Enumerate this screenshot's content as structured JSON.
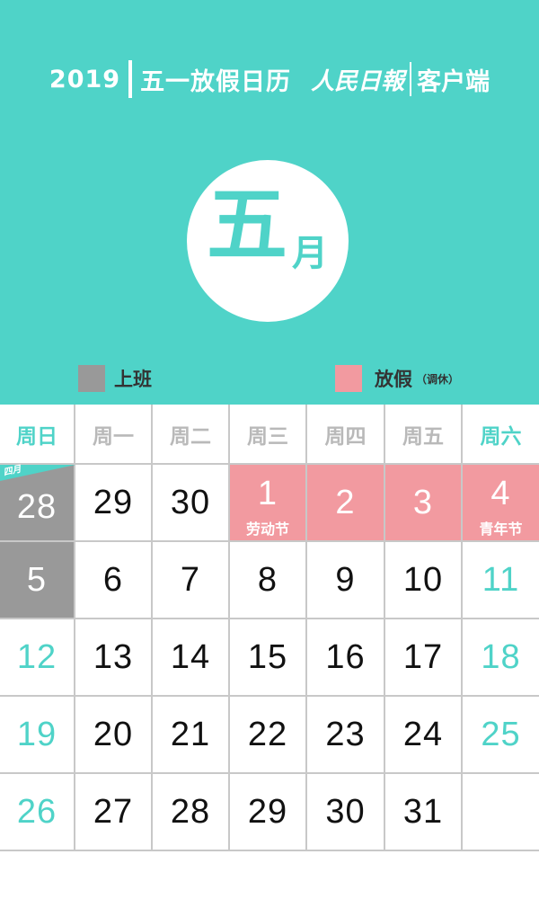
{
  "header": {
    "year": "2019",
    "title": "五一放假日历",
    "brand": "人民日報",
    "client": "客户端",
    "month_big": "五",
    "month_small": "月",
    "background_color": "#4fd3c8"
  },
  "legend": {
    "work": {
      "label": "上班",
      "color": "#999999"
    },
    "holiday": {
      "label": "放假",
      "note": "（调休）",
      "color": "#f29aa0"
    }
  },
  "calendar": {
    "weekdays": [
      "周日",
      "周一",
      "周二",
      "周三",
      "周四",
      "周五",
      "周六"
    ],
    "weeks": [
      [
        {
          "day": "28",
          "type": "work",
          "tag": "四月"
        },
        {
          "day": "29",
          "type": "normal"
        },
        {
          "day": "30",
          "type": "normal"
        },
        {
          "day": "1",
          "type": "holiday",
          "note": "劳动节"
        },
        {
          "day": "2",
          "type": "holiday"
        },
        {
          "day": "3",
          "type": "holiday"
        },
        {
          "day": "4",
          "type": "holiday",
          "note": "青年节"
        }
      ],
      [
        {
          "day": "5",
          "type": "work"
        },
        {
          "day": "6",
          "type": "normal"
        },
        {
          "day": "7",
          "type": "normal"
        },
        {
          "day": "8",
          "type": "normal"
        },
        {
          "day": "9",
          "type": "normal"
        },
        {
          "day": "10",
          "type": "normal"
        },
        {
          "day": "11",
          "type": "weekend"
        }
      ],
      [
        {
          "day": "12",
          "type": "weekend"
        },
        {
          "day": "13",
          "type": "normal"
        },
        {
          "day": "14",
          "type": "normal"
        },
        {
          "day": "15",
          "type": "normal"
        },
        {
          "day": "16",
          "type": "normal"
        },
        {
          "day": "17",
          "type": "normal"
        },
        {
          "day": "18",
          "type": "weekend"
        }
      ],
      [
        {
          "day": "19",
          "type": "weekend"
        },
        {
          "day": "20",
          "type": "normal"
        },
        {
          "day": "21",
          "type": "normal"
        },
        {
          "day": "22",
          "type": "normal"
        },
        {
          "day": "23",
          "type": "normal"
        },
        {
          "day": "24",
          "type": "normal"
        },
        {
          "day": "25",
          "type": "weekend"
        }
      ],
      [
        {
          "day": "26",
          "type": "weekend"
        },
        {
          "day": "27",
          "type": "normal"
        },
        {
          "day": "28",
          "type": "normal"
        },
        {
          "day": "29",
          "type": "normal"
        },
        {
          "day": "30",
          "type": "normal"
        },
        {
          "day": "31",
          "type": "normal"
        },
        {
          "day": "",
          "type": "empty"
        }
      ]
    ]
  }
}
